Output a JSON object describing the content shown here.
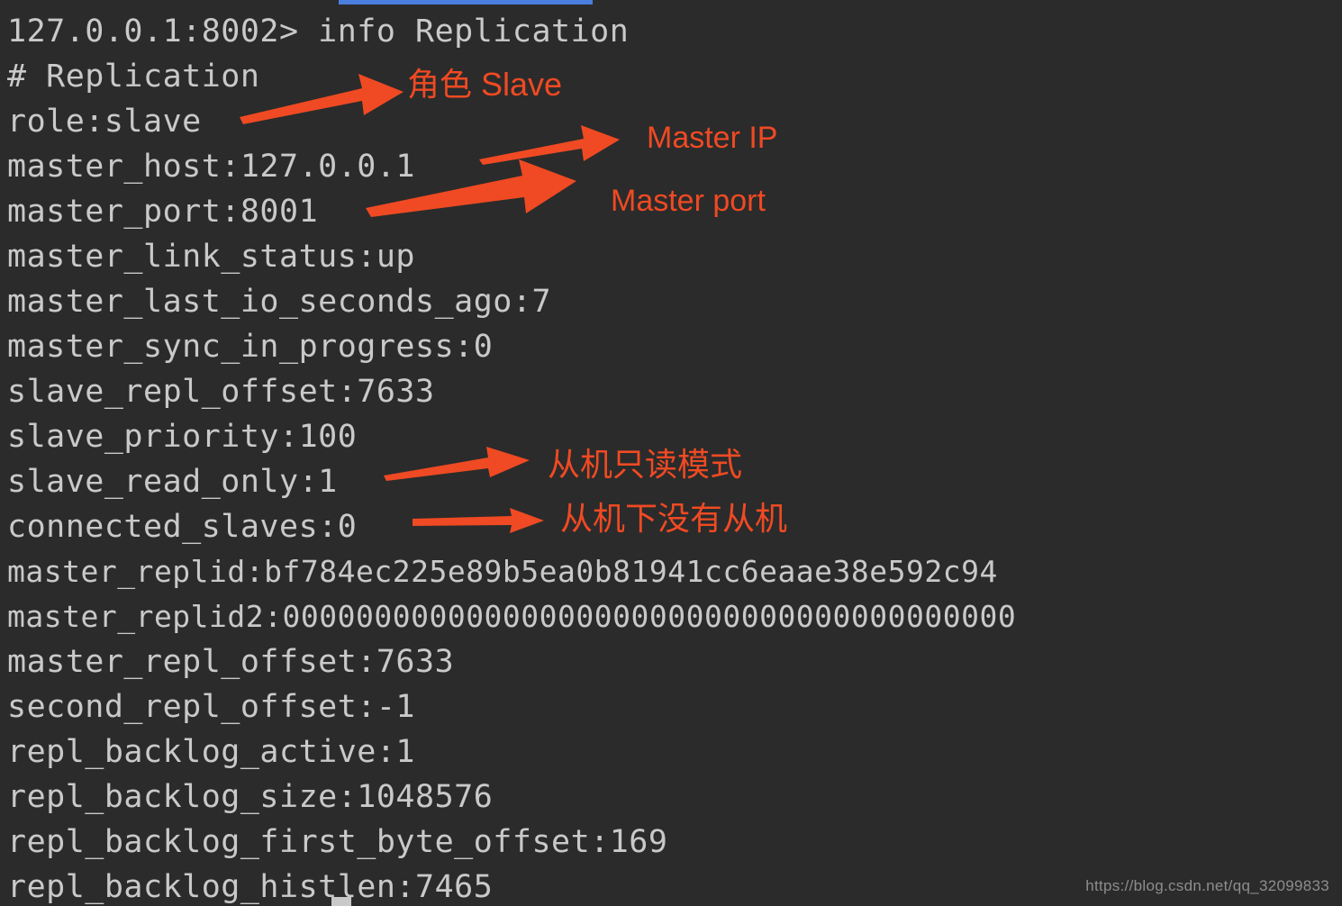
{
  "window": {
    "background_color": "#2b2b2b",
    "text_color": "#c9c9c9",
    "accent_color": "#ef4a23",
    "selection_color": "#4a7fe0"
  },
  "terminal": {
    "prompt_line": "127.0.0.1:8002> info Replication",
    "lines": [
      "127.0.0.1:8002> info Replication",
      "# Replication",
      "role:slave",
      "master_host:127.0.0.1",
      "master_port:8001",
      "master_link_status:up",
      "master_last_io_seconds_ago:7",
      "master_sync_in_progress:0",
      "slave_repl_offset:7633",
      "slave_priority:100",
      "slave_read_only:1",
      "connected_slaves:0",
      "master_replid:bf784ec225e89b5ea0b81941cc6eaae38e592c94",
      "master_replid2:0000000000000000000000000000000000000000",
      "master_repl_offset:7633",
      "second_repl_offset:-1",
      "repl_backlog_active:1",
      "repl_backlog_size:1048576",
      "repl_backlog_first_byte_offset:169",
      "repl_backlog_histlen:7465"
    ],
    "fields": [
      {
        "key": "role",
        "value": "slave"
      },
      {
        "key": "master_host",
        "value": "127.0.0.1"
      },
      {
        "key": "master_port",
        "value": "8001"
      },
      {
        "key": "master_link_status",
        "value": "up"
      },
      {
        "key": "master_last_io_seconds_ago",
        "value": "7"
      },
      {
        "key": "master_sync_in_progress",
        "value": "0"
      },
      {
        "key": "slave_repl_offset",
        "value": "7633"
      },
      {
        "key": "slave_priority",
        "value": "100"
      },
      {
        "key": "slave_read_only",
        "value": "1"
      },
      {
        "key": "connected_slaves",
        "value": "0"
      },
      {
        "key": "master_replid",
        "value": "bf784ec225e89b5ea0b81941cc6eaae38e592c94"
      },
      {
        "key": "master_replid2",
        "value": "0000000000000000000000000000000000000000"
      },
      {
        "key": "master_repl_offset",
        "value": "7633"
      },
      {
        "key": "second_repl_offset",
        "value": "-1"
      },
      {
        "key": "repl_backlog_active",
        "value": "1"
      },
      {
        "key": "repl_backlog_size",
        "value": "1048576"
      },
      {
        "key": "repl_backlog_first_byte_offset",
        "value": "169"
      },
      {
        "key": "repl_backlog_histlen",
        "value": "7465"
      }
    ]
  },
  "annotations": [
    {
      "id": "role-slave",
      "text": "角色 Slave",
      "points_to": "role:slave"
    },
    {
      "id": "master-ip",
      "text": "Master IP",
      "points_to": "master_host:127.0.0.1"
    },
    {
      "id": "master-port",
      "text": "Master port",
      "points_to": "master_port:8001"
    },
    {
      "id": "slave-read-only",
      "text": "从机只读模式",
      "points_to": "slave_read_only:1"
    },
    {
      "id": "no-sub-slaves",
      "text": "从机下没有从机",
      "points_to": "connected_slaves:0"
    }
  ],
  "watermark": {
    "url": "https://blog.csdn.net/qq_32099833"
  }
}
